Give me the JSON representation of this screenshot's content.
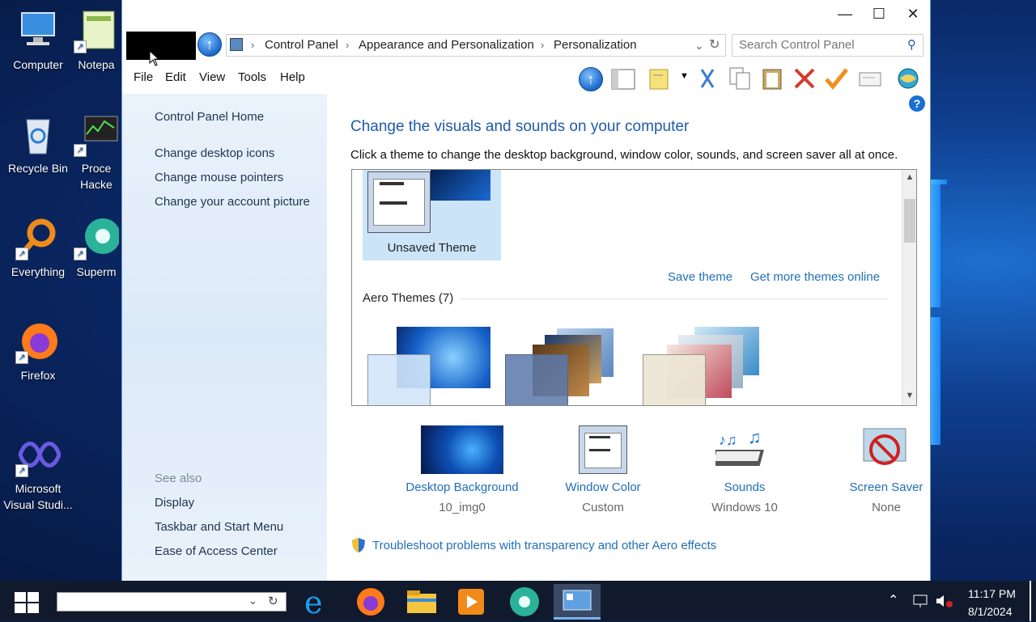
{
  "desktop": {
    "icons": [
      {
        "label": "Computer"
      },
      {
        "label": "Notepa"
      },
      {
        "label": "Recycle Bin"
      },
      {
        "label": "Proce Hacke"
      },
      {
        "label": "Everything"
      },
      {
        "label": "Superm"
      },
      {
        "label": "Firefox"
      },
      {
        "label": "Microsoft Visual Studi..."
      }
    ]
  },
  "window": {
    "breadcrumb": [
      "Control Panel",
      "Appearance and Personalization",
      "Personalization"
    ],
    "search_placeholder": "Search Control Panel",
    "menu": [
      "File",
      "Edit",
      "View",
      "Tools",
      "Help"
    ],
    "left_pane": {
      "home": "Control Panel Home",
      "tasks": [
        "Change desktop icons",
        "Change mouse pointers",
        "Change your account picture"
      ],
      "see_also_label": "See also",
      "see_also": [
        "Display",
        "Taskbar and Start Menu",
        "Ease of Access Center"
      ]
    },
    "content": {
      "heading": "Change the visuals and sounds on your computer",
      "subheading": "Click a theme to change the desktop background, window color, sounds, and screen saver all at once.",
      "unsaved_theme": "Unsaved Theme",
      "save_theme": "Save theme",
      "get_more": "Get more themes online",
      "aero_group": "Aero Themes (7)",
      "bottom": [
        {
          "title": "Desktop Background",
          "value": "10_img0"
        },
        {
          "title": "Window Color",
          "value": "Custom"
        },
        {
          "title": "Sounds",
          "value": "Windows 10"
        },
        {
          "title": "Screen Saver",
          "value": "None"
        }
      ],
      "troubleshoot": "Troubleshoot problems with transparency and other Aero effects"
    },
    "help_label": "?"
  },
  "taskbar": {
    "time": "11:17 PM",
    "date": "8/1/2024"
  }
}
